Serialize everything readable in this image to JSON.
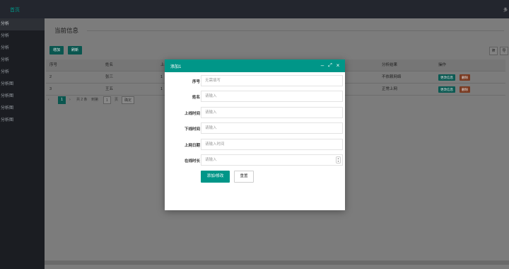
{
  "topbar": {
    "brand": "首页",
    "right_text": "多"
  },
  "sidebar": {
    "items": [
      {
        "label": "分析"
      },
      {
        "label": "分析"
      },
      {
        "label": "分析"
      },
      {
        "label": "分析"
      },
      {
        "label": "分析"
      },
      {
        "label": "分析图"
      },
      {
        "label": "分析图"
      },
      {
        "label": "分析图"
      },
      {
        "label": "分析图"
      }
    ]
  },
  "main": {
    "title": "当前信息",
    "toolbar": {
      "add_label": "增加",
      "refresh_label": "刷新",
      "icon1": "筛",
      "icon2": "导"
    },
    "table": {
      "headers": [
        "序号",
        "姓名",
        "上",
        "分析结果",
        "操作"
      ],
      "rows": [
        {
          "id": "2",
          "name": "张三",
          "col3": "1",
          "result": "不依赖网络"
        },
        {
          "id": "3",
          "name": "王五",
          "col3": "1",
          "result": "正常上网"
        }
      ],
      "edit_label": "更改信息",
      "delete_label": "删除"
    },
    "pager": {
      "prev": "‹",
      "current": "1",
      "next": "›",
      "total": "共 2 条",
      "goto": "到第",
      "page_value": "1",
      "page_unit": "页",
      "confirm": "确定"
    }
  },
  "dialog": {
    "title": "添加1",
    "fields": [
      {
        "label": "序号",
        "placeholder": "无需填写"
      },
      {
        "label": "姓名",
        "placeholder": "请输入"
      },
      {
        "label": "上线时间",
        "placeholder": "请输入"
      },
      {
        "label": "下线时间",
        "placeholder": "请输入"
      },
      {
        "label": "上网日期",
        "placeholder": "请输入时间"
      },
      {
        "label": "在线时长",
        "placeholder": "请输入"
      }
    ],
    "submit_label": "添加/修改",
    "reset_label": "重置"
  }
}
